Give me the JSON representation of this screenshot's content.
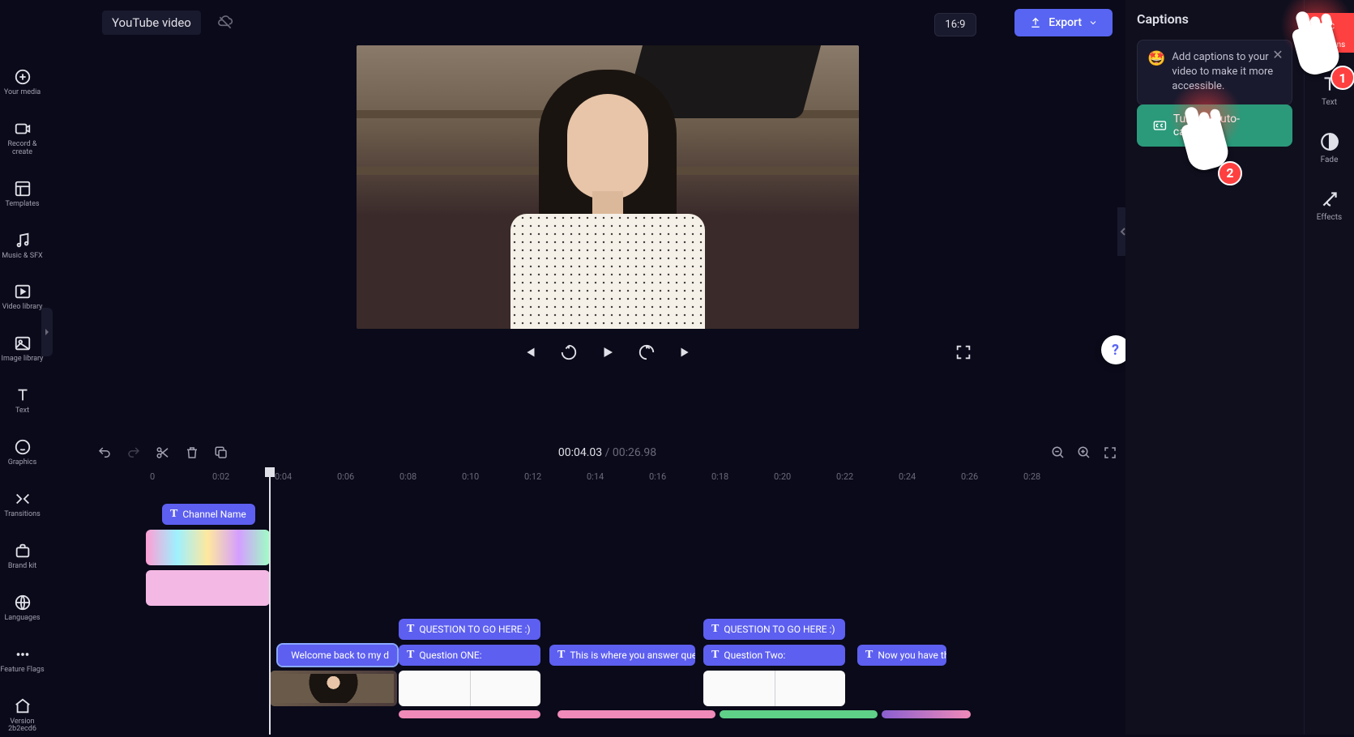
{
  "project": {
    "title": "YouTube video"
  },
  "export": {
    "label": "Export"
  },
  "aspect_ratio": "16:9",
  "left_sidebar": {
    "items": [
      {
        "label": "Your media"
      },
      {
        "label": "Record & create"
      },
      {
        "label": "Templates"
      },
      {
        "label": "Music & SFX"
      },
      {
        "label": "Video library"
      },
      {
        "label": "Image library"
      },
      {
        "label": "Text"
      },
      {
        "label": "Graphics"
      },
      {
        "label": "Transitions"
      },
      {
        "label": "Brand kit"
      },
      {
        "label": "Languages"
      },
      {
        "label": "Feature Flags"
      },
      {
        "label": "Version 2b2ecd6"
      }
    ]
  },
  "playback": {
    "current_time": "00:04.03",
    "separator": " / ",
    "total_time": "00:26.98"
  },
  "ruler_marks": [
    "0",
    "0:02",
    "0:04",
    "0:06",
    "0:08",
    "0:10",
    "0:12",
    "0:14",
    "0:16",
    "0:18",
    "0:20",
    "0:22",
    "0:24",
    "0:26",
    "0:28"
  ],
  "timeline": {
    "channel_clip": "Channel Name",
    "question_heading_1": "QUESTION TO GO HERE :)",
    "question_heading_2": "QUESTION TO GO HERE :)",
    "welcome_text": "Welcome back to my d",
    "q1_text": "Question ONE:",
    "answer_text": "This is where you answer quest",
    "q2_text": "Question Two:",
    "now_text": "Now you have th"
  },
  "captions_panel": {
    "title": "Captions",
    "tip_text": "Add captions to your video to make it more accessible.",
    "auto_button": "Turn on auto-captions"
  },
  "right_sidebar": {
    "items": [
      {
        "label": "Captions"
      },
      {
        "label": "Text"
      },
      {
        "label": "Fade"
      },
      {
        "label": "Effects"
      }
    ]
  },
  "annotations": {
    "badge1": "1",
    "badge2": "2"
  }
}
